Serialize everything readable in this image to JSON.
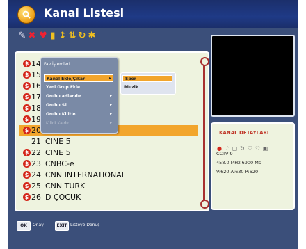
{
  "header": {
    "title": "Kanal Listesi",
    "logo_icon": "magnifier-icon"
  },
  "toolbar": {
    "icons": [
      "edit-icon",
      "delete-icon",
      "favorite-icon",
      "lock-icon",
      "move-icon",
      "sort-icon",
      "rename-icon",
      "asterisk-icon"
    ]
  },
  "channels": [
    {
      "num": "14",
      "name": "",
      "scrambled": true
    },
    {
      "num": "15",
      "name": "",
      "scrambled": true
    },
    {
      "num": "16",
      "name": "",
      "scrambled": true
    },
    {
      "num": "17",
      "name": "",
      "scrambled": true
    },
    {
      "num": "18",
      "name": "",
      "scrambled": true
    },
    {
      "num": "19",
      "name": "",
      "scrambled": true
    },
    {
      "num": "20",
      "name": "",
      "scrambled": true,
      "selected": true
    },
    {
      "num": "21",
      "name": "CINE 5",
      "scrambled": false
    },
    {
      "num": "22",
      "name": "CINE 5",
      "scrambled": true
    },
    {
      "num": "23",
      "name": "CNBC-e",
      "scrambled": true
    },
    {
      "num": "24",
      "name": "CNN INTERNATIONAL",
      "scrambled": true
    },
    {
      "num": "25",
      "name": "CNN TÜRK",
      "scrambled": true
    },
    {
      "num": "26",
      "name": "D ÇOCUK",
      "scrambled": true
    }
  ],
  "menu": {
    "title": "Fav İşlemleri",
    "items": [
      {
        "label": "Kanal Ekle/Çıkar",
        "selected": true,
        "has_sub": true,
        "disabled": false
      },
      {
        "label": "Yeni Grup Ekle",
        "selected": false,
        "has_sub": false,
        "disabled": false
      },
      {
        "label": "Grubu adlandır",
        "selected": false,
        "has_sub": true,
        "disabled": false
      },
      {
        "label": "Grubu Sil",
        "selected": false,
        "has_sub": true,
        "disabled": false
      },
      {
        "label": "Grubu Kilitle",
        "selected": false,
        "has_sub": true,
        "disabled": false
      },
      {
        "label": "Kilidi Kaldır",
        "selected": false,
        "has_sub": true,
        "disabled": true
      }
    ]
  },
  "submenu": {
    "items": [
      {
        "label": "Spor",
        "selected": true
      },
      {
        "label": "Muzik",
        "selected": false
      }
    ]
  },
  "details": {
    "title": "KANAL DETAYLARI",
    "channel_name": "CCTV 9",
    "frequency": "458.0 MHz 6900 Ms",
    "pids": "V:620 A:630 P:620"
  },
  "footer": {
    "ok_key": "OK",
    "ok_label": "Onay",
    "exit_key": "EXIT",
    "exit_label": "Listeye Dönüş"
  },
  "colors": {
    "background": "#3b4f7a",
    "titlebar": "#1f3a86",
    "selection": "#f2a52c",
    "scrambled_marker": "#d4271b",
    "panel": "#eef3df"
  }
}
